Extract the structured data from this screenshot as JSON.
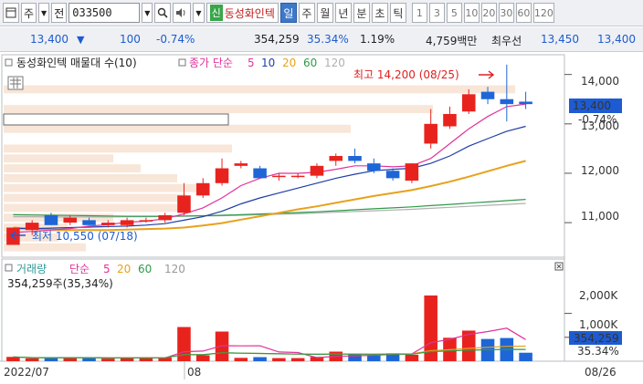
{
  "toolbar": {
    "code": "033500",
    "stock_name": "동성화인텍",
    "new_badge": "신",
    "ju_label": "주",
    "jeon_label": "전",
    "periods": [
      "일",
      "주",
      "월",
      "년",
      "분",
      "초",
      "틱"
    ],
    "active_period": "일",
    "intervals": [
      "1",
      "3",
      "5",
      "10",
      "20",
      "30",
      "60",
      "120"
    ]
  },
  "quote": {
    "price": "13,400",
    "change": "100",
    "change_pct": "-0.74%",
    "volume": "354,259",
    "volume_ratio": "35.34%",
    "turnover": "1.19%",
    "amount": "4,759백만",
    "best_ask_label": "최우선",
    "best_ask": "13,450",
    "best_bid": "13,400"
  },
  "price_panel": {
    "title": "동성화인텍 매물대 수(10)",
    "ma_prefix": "종가 단순",
    "ma_periods": [
      "5",
      "10",
      "20",
      "60",
      "120"
    ],
    "ma_colors": [
      "#e0339a",
      "#1f3ea8",
      "#e8a11a",
      "#2f9a4a",
      "#b0b0b0"
    ],
    "high_annotation": "최고 14,200 (08/25)",
    "low_annotation": "최저 10,550 (07/18)",
    "current_label": "13,400",
    "current_change_label": "-0.74%",
    "y_ticks": [
      "14,000",
      "13,000",
      "12,000",
      "11,000"
    ]
  },
  "volume_panel": {
    "title": "거래량",
    "ma_prefix": "단순",
    "ma_periods": [
      "5",
      "20",
      "60",
      "120"
    ],
    "value_text": "354,259주(35,34%)",
    "current_label": "354,259",
    "current_pct_label": "35.34%",
    "y_ticks": [
      "2,000K",
      "1,000K"
    ]
  },
  "x_axis": {
    "labels": [
      "2022/07",
      "08",
      "08/26"
    ]
  },
  "chart_data": {
    "type": "candlestick",
    "ylim": [
      10300,
      14400
    ],
    "candles": [
      {
        "o": 10550,
        "h": 10650,
        "l": 10550,
        "c": 10900
      },
      {
        "o": 10850,
        "h": 11050,
        "l": 10750,
        "c": 11000
      },
      {
        "o": 11150,
        "h": 11200,
        "l": 10950,
        "c": 10950
      },
      {
        "o": 11000,
        "h": 11150,
        "l": 10950,
        "c": 11100
      },
      {
        "o": 11050,
        "h": 11100,
        "l": 10950,
        "c": 10950
      },
      {
        "o": 10950,
        "h": 11050,
        "l": 10900,
        "c": 11000
      },
      {
        "o": 10950,
        "h": 11100,
        "l": 10900,
        "c": 11050
      },
      {
        "o": 11050,
        "h": 11100,
        "l": 11000,
        "c": 11050
      },
      {
        "o": 11050,
        "h": 11200,
        "l": 11000,
        "c": 11150
      },
      {
        "o": 11200,
        "h": 11800,
        "l": 11150,
        "c": 11550
      },
      {
        "o": 11550,
        "h": 11900,
        "l": 11500,
        "c": 11800
      },
      {
        "o": 11800,
        "h": 12300,
        "l": 11750,
        "c": 12100
      },
      {
        "o": 12150,
        "h": 12250,
        "l": 12100,
        "c": 12200
      },
      {
        "o": 12100,
        "h": 12150,
        "l": 11900,
        "c": 11900
      },
      {
        "o": 11950,
        "h": 12000,
        "l": 11850,
        "c": 11950
      },
      {
        "o": 11950,
        "h": 12000,
        "l": 11900,
        "c": 11950
      },
      {
        "o": 11950,
        "h": 12200,
        "l": 11900,
        "c": 12150
      },
      {
        "o": 12250,
        "h": 12400,
        "l": 12150,
        "c": 12350
      },
      {
        "o": 12350,
        "h": 12500,
        "l": 12200,
        "c": 12250
      },
      {
        "o": 12200,
        "h": 12300,
        "l": 12000,
        "c": 12050
      },
      {
        "o": 12050,
        "h": 12100,
        "l": 11850,
        "c": 11900
      },
      {
        "o": 11850,
        "h": 12200,
        "l": 11800,
        "c": 12200
      },
      {
        "o": 12600,
        "h": 13300,
        "l": 12500,
        "c": 13000
      },
      {
        "o": 12950,
        "h": 13350,
        "l": 12900,
        "c": 13200
      },
      {
        "o": 13250,
        "h": 13700,
        "l": 13200,
        "c": 13600
      },
      {
        "o": 13650,
        "h": 13750,
        "l": 13400,
        "c": 13500
      },
      {
        "o": 13500,
        "h": 14200,
        "l": 13050,
        "c": 13400
      },
      {
        "o": 13450,
        "h": 13650,
        "l": 13300,
        "c": 13400
      }
    ],
    "ma5": [
      10800,
      10820,
      10850,
      10880,
      10930,
      10960,
      11010,
      11030,
      11080,
      11180,
      11300,
      11500,
      11750,
      11900,
      12000,
      12000,
      12020,
      12080,
      12150,
      12150,
      12130,
      12150,
      12300,
      12600,
      12900,
      13150,
      13350,
      13400
    ],
    "ma10": [
      10880,
      10880,
      10890,
      10900,
      10910,
      10920,
      10930,
      10950,
      10980,
      11050,
      11120,
      11230,
      11380,
      11500,
      11600,
      11700,
      11800,
      11900,
      11980,
      12050,
      12080,
      12100,
      12200,
      12350,
      12550,
      12700,
      12850,
      12950
    ],
    "ma20": [
      10900,
      10880,
      10860,
      10850,
      10850,
      10850,
      10860,
      10870,
      10880,
      10900,
      10940,
      10990,
      11060,
      11130,
      11200,
      11270,
      11330,
      11400,
      11470,
      11540,
      11600,
      11660,
      11740,
      11830,
      11930,
      12040,
      12150,
      12250
    ],
    "ma60": [
      11160,
      11155,
      11150,
      11145,
      11140,
      11135,
      11130,
      11130,
      11130,
      11135,
      11140,
      11150,
      11160,
      11175,
      11190,
      11205,
      11220,
      11240,
      11260,
      11280,
      11300,
      11320,
      11345,
      11370,
      11395,
      11420,
      11445,
      11470
    ],
    "ma120": [
      11120,
      11120,
      11115,
      11115,
      11115,
      11115,
      11120,
      11120,
      11125,
      11130,
      11135,
      11140,
      11150,
      11160,
      11170,
      11180,
      11195,
      11210,
      11225,
      11240,
      11255,
      11270,
      11290,
      11310,
      11330,
      11350,
      11370,
      11390
    ],
    "volumes_k": [
      180,
      120,
      150,
      150,
      140,
      110,
      130,
      160,
      150,
      1430,
      250,
      1240,
      140,
      170,
      130,
      130,
      180,
      400,
      290,
      240,
      330,
      270,
      2750,
      980,
      1280,
      930,
      970,
      354
    ],
    "volume_ylim": [
      0,
      2900
    ]
  }
}
